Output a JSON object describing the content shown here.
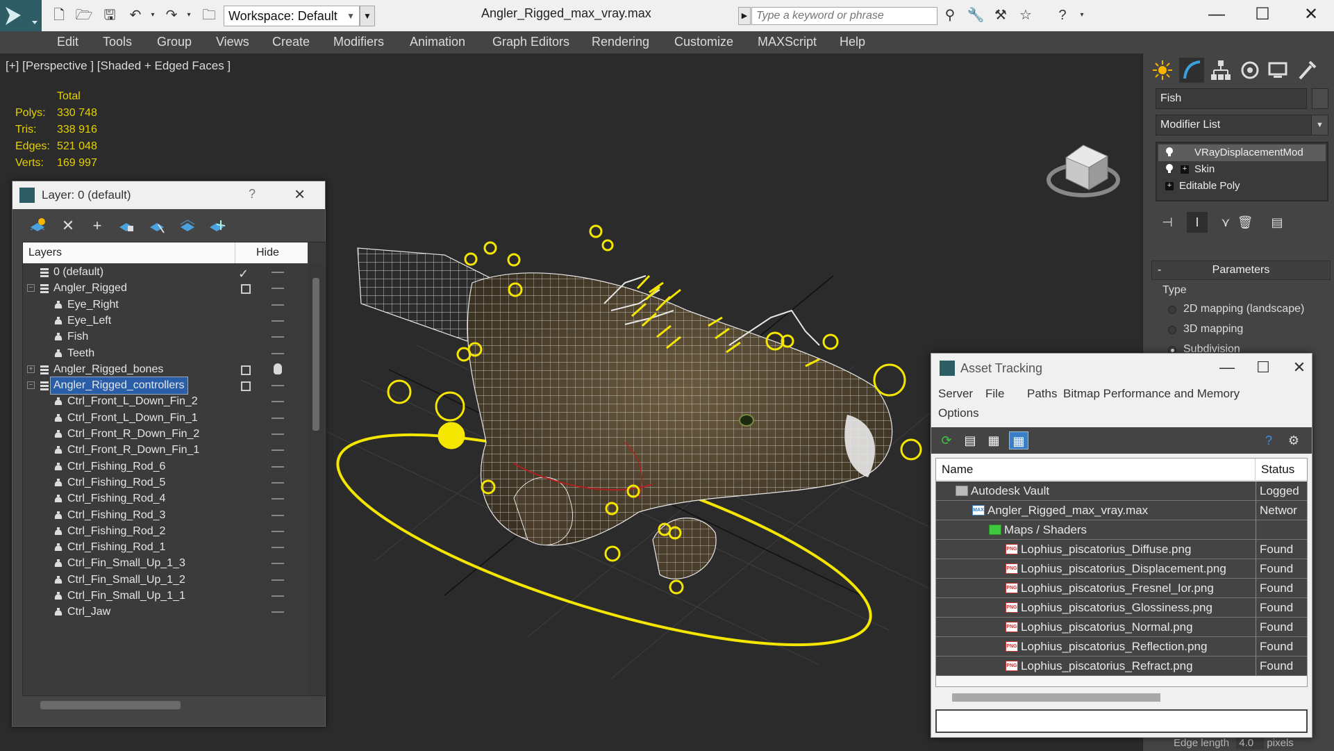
{
  "window": {
    "title": "Angler_Rigged_max_vray.max",
    "workspace_label": "Workspace: Default",
    "search_placeholder": "Type a keyword or phrase"
  },
  "menu": [
    "Edit",
    "Tools",
    "Group",
    "Views",
    "Create",
    "Modifiers",
    "Animation",
    "Graph Editors",
    "Rendering",
    "Customize",
    "MAXScript",
    "Help"
  ],
  "viewport": {
    "label": "[+] [Perspective ] [Shaded + Edged Faces ]",
    "stats_header": "Total",
    "stats": [
      {
        "label": "Polys:",
        "value": "330 748"
      },
      {
        "label": "Tris:",
        "value": "338 916"
      },
      {
        "label": "Edges:",
        "value": "521 048"
      },
      {
        "label": "Verts:",
        "value": "169 997"
      }
    ]
  },
  "command_panel": {
    "object_name": "Fish",
    "modifier_list_label": "Modifier List",
    "stack": [
      "VRayDisplacementMod",
      "Skin",
      "Editable Poly"
    ],
    "parameters_title": "Parameters",
    "type_label": "Type",
    "type_options": [
      {
        "label": "2D mapping (landscape)",
        "selected": false
      },
      {
        "label": "3D mapping",
        "selected": false
      },
      {
        "label": "Subdivision",
        "selected": true
      }
    ],
    "edge_length_label": "Edge length",
    "edge_length_value": "4.0",
    "edge_length_unit": "pixels"
  },
  "layer_dialog": {
    "title": "Layer: 0 (default)",
    "help": "?",
    "col_layers": "Layers",
    "col_hide": "Hide",
    "rows": [
      {
        "name": "0 (default)",
        "level": 0,
        "kind": "layer",
        "current": true
      },
      {
        "name": "Angler_Rigged",
        "level": 0,
        "kind": "layer",
        "expand": "−"
      },
      {
        "name": "Eye_Right",
        "level": 1,
        "kind": "object"
      },
      {
        "name": "Eye_Left",
        "level": 1,
        "kind": "object"
      },
      {
        "name": "Fish",
        "level": 1,
        "kind": "object"
      },
      {
        "name": "Teeth",
        "level": 1,
        "kind": "object"
      },
      {
        "name": "Angler_Rigged_bones",
        "level": 0,
        "kind": "layer",
        "expand": "+",
        "bulb": true
      },
      {
        "name": "Angler_Rigged_controllers",
        "level": 0,
        "kind": "layer",
        "expand": "−",
        "selected": true
      },
      {
        "name": "Ctrl_Front_L_Down_Fin_2",
        "level": 1,
        "kind": "object"
      },
      {
        "name": "Ctrl_Front_L_Down_Fin_1",
        "level": 1,
        "kind": "object"
      },
      {
        "name": "Ctrl_Front_R_Down_Fin_2",
        "level": 1,
        "kind": "object"
      },
      {
        "name": "Ctrl_Front_R_Down_Fin_1",
        "level": 1,
        "kind": "object"
      },
      {
        "name": "Ctrl_Fishing_Rod_6",
        "level": 1,
        "kind": "object"
      },
      {
        "name": "Ctrl_Fishing_Rod_5",
        "level": 1,
        "kind": "object"
      },
      {
        "name": "Ctrl_Fishing_Rod_4",
        "level": 1,
        "kind": "object"
      },
      {
        "name": "Ctrl_Fishing_Rod_3",
        "level": 1,
        "kind": "object"
      },
      {
        "name": "Ctrl_Fishing_Rod_2",
        "level": 1,
        "kind": "object"
      },
      {
        "name": "Ctrl_Fishing_Rod_1",
        "level": 1,
        "kind": "object"
      },
      {
        "name": "Ctrl_Fin_Small_Up_1_3",
        "level": 1,
        "kind": "object"
      },
      {
        "name": "Ctrl_Fin_Small_Up_1_2",
        "level": 1,
        "kind": "object"
      },
      {
        "name": "Ctrl_Fin_Small_Up_1_1",
        "level": 1,
        "kind": "object"
      },
      {
        "name": "Ctrl_Jaw",
        "level": 1,
        "kind": "object"
      }
    ]
  },
  "asset_dialog": {
    "title": "Asset Tracking",
    "menu_row1": [
      "Server",
      "File",
      "Paths",
      "Bitmap Performance and Memory"
    ],
    "menu_row2": [
      "Options"
    ],
    "col_name": "Name",
    "col_status": "Status",
    "rows": [
      {
        "name": "Autodesk Vault",
        "status": "Logged",
        "level": 0,
        "icon": "vault"
      },
      {
        "name": "Angler_Rigged_max_vray.max",
        "status": "Networ",
        "level": 1,
        "icon": "max"
      },
      {
        "name": "Maps / Shaders",
        "status": "",
        "level": 2,
        "icon": "maps"
      },
      {
        "name": "Lophius_piscatorius_Diffuse.png",
        "status": "Found",
        "level": 3,
        "icon": "png"
      },
      {
        "name": "Lophius_piscatorius_Displacement.png",
        "status": "Found",
        "level": 3,
        "icon": "png"
      },
      {
        "name": "Lophius_piscatorius_Fresnel_Ior.png",
        "status": "Found",
        "level": 3,
        "icon": "png"
      },
      {
        "name": "Lophius_piscatorius_Glossiness.png",
        "status": "Found",
        "level": 3,
        "icon": "png"
      },
      {
        "name": "Lophius_piscatorius_Normal.png",
        "status": "Found",
        "level": 3,
        "icon": "png"
      },
      {
        "name": "Lophius_piscatorius_Reflection.png",
        "status": "Found",
        "level": 3,
        "icon": "png"
      },
      {
        "name": "Lophius_piscatorius_Refract.png",
        "status": "Found",
        "level": 3,
        "icon": "png"
      }
    ]
  },
  "colors": {
    "accent": "#2a5ea8",
    "controller_yellow": "#f5e600",
    "stats_yellow": "#e6d200",
    "ui_dark": "#444444",
    "viewport_bg": "#2b2b2b"
  }
}
